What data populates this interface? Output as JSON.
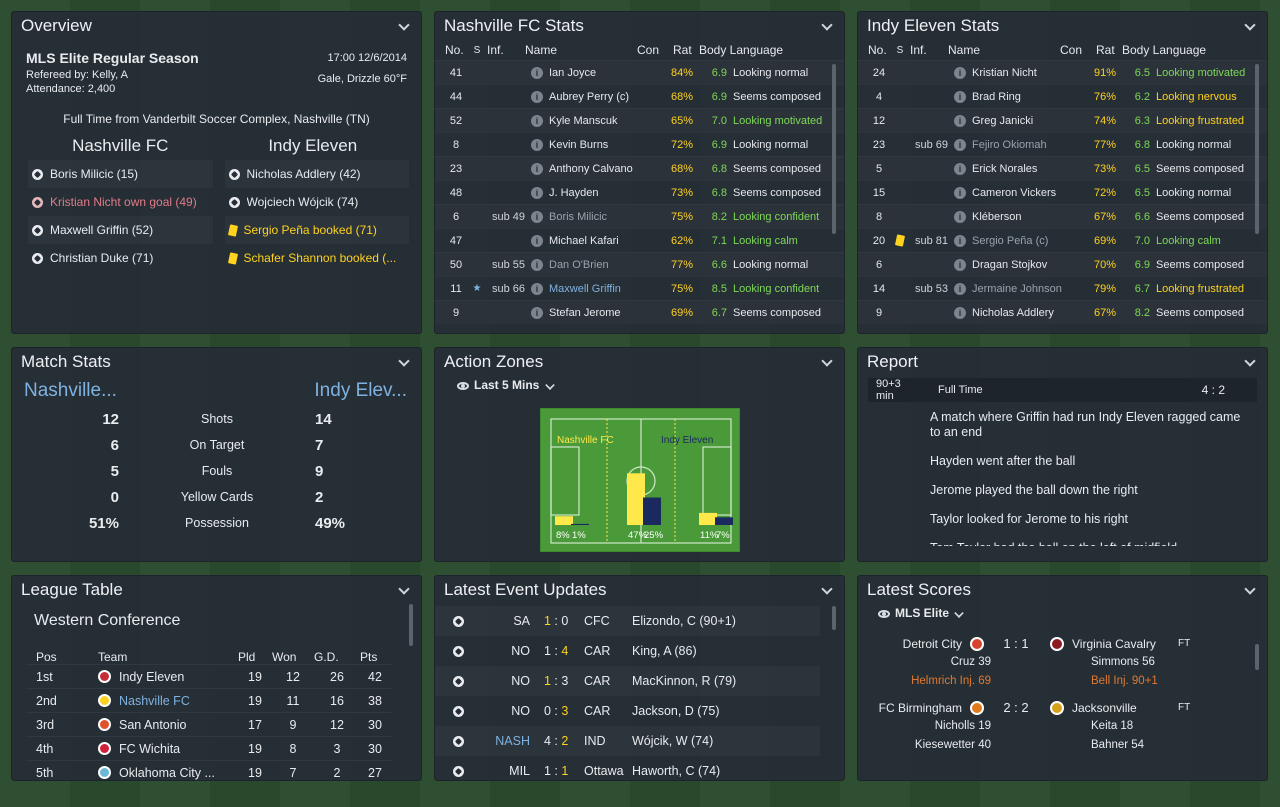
{
  "overview": {
    "title": "Overview",
    "competition": "MLS Elite Regular Season",
    "datetime": "17:00 12/6/2014",
    "referee": "Refereed by: Kelly, A",
    "weather": "Gale, Drizzle 60°F",
    "attendance": "Attendance: 2,400",
    "result": "Full Time from Vanderbilt Soccer Complex, Nashville (TN)",
    "home": "Nashville FC",
    "away": "Indy Eleven",
    "home_events": [
      {
        "text": "Boris Milicic (15)",
        "type": "goal"
      },
      {
        "text": "Kristian Nicht own goal (49)",
        "type": "own"
      },
      {
        "text": "Maxwell Griffin (52)",
        "type": "goal"
      },
      {
        "text": "Christian Duke (71)",
        "type": "goal"
      }
    ],
    "away_events": [
      {
        "text": "Nicholas Addlery (42)",
        "type": "goal"
      },
      {
        "text": "Wojciech Wójcik (74)",
        "type": "goal"
      },
      {
        "text": "Sergio Peña booked (71)",
        "type": "card"
      },
      {
        "text": "Schafer Shannon booked (...",
        "type": "card"
      }
    ]
  },
  "stats_headers": {
    "no": "No.",
    "s": "S",
    "inf": "Inf.",
    "name": "Name",
    "con": "Con",
    "rat": "Rat",
    "bl": "Body Language"
  },
  "home_stats": {
    "title": "Nashville FC Stats",
    "rows": [
      {
        "no": "41",
        "s": "",
        "inf": "",
        "name": "Ian Joyce",
        "con": "84%",
        "rat": "6.9",
        "bl": "Looking normal",
        "bc": "w"
      },
      {
        "no": "44",
        "s": "",
        "inf": "",
        "name": "Aubrey Perry (c)",
        "con": "68%",
        "rat": "6.9",
        "bl": "Seems composed",
        "bc": "w"
      },
      {
        "no": "52",
        "s": "",
        "inf": "",
        "name": "Kyle Manscuk",
        "con": "65%",
        "rat": "7.0",
        "bl": "Looking motivated",
        "bc": "g"
      },
      {
        "no": "8",
        "s": "",
        "inf": "",
        "name": "Kevin Burns",
        "con": "72%",
        "rat": "6.9",
        "bl": "Looking normal",
        "bc": "w"
      },
      {
        "no": "23",
        "s": "",
        "inf": "",
        "name": "Anthony Calvano",
        "con": "68%",
        "rat": "6.8",
        "bl": "Seems composed",
        "bc": "w"
      },
      {
        "no": "48",
        "s": "",
        "inf": "",
        "name": "J. Hayden",
        "con": "73%",
        "rat": "6.8",
        "bl": "Seems composed",
        "bc": "w"
      },
      {
        "no": "6",
        "s": "",
        "inf": "sub 49",
        "name": "Boris Milicic",
        "con": "75%",
        "rat": "8.2",
        "bl": "Looking confident",
        "bc": "g",
        "dim": true
      },
      {
        "no": "47",
        "s": "",
        "inf": "",
        "name": "Michael Kafari",
        "con": "62%",
        "rat": "7.1",
        "bl": "Looking calm",
        "bc": "g"
      },
      {
        "no": "50",
        "s": "",
        "inf": "sub 55",
        "name": "Dan O'Brien",
        "con": "77%",
        "rat": "6.6",
        "bl": "Looking normal",
        "bc": "w",
        "dim": true
      },
      {
        "no": "11",
        "s": "★",
        "inf": "sub 66",
        "name": "Maxwell Griffin",
        "con": "75%",
        "rat": "8.5",
        "bl": "Looking confident",
        "bc": "g",
        "link": true
      },
      {
        "no": "9",
        "s": "",
        "inf": "",
        "name": "Stefan Jerome",
        "con": "69%",
        "rat": "6.7",
        "bl": "Seems composed",
        "bc": "w"
      }
    ]
  },
  "away_stats": {
    "title": "Indy Eleven Stats",
    "rows": [
      {
        "no": "24",
        "s": "",
        "inf": "",
        "name": "Kristian Nicht",
        "con": "91%",
        "rat": "6.5",
        "bl": "Looking motivated",
        "bc": "g"
      },
      {
        "no": "4",
        "s": "",
        "inf": "",
        "name": "Brad Ring",
        "con": "76%",
        "rat": "6.2",
        "bl": "Looking nervous",
        "bc": "y"
      },
      {
        "no": "12",
        "s": "",
        "inf": "",
        "name": "Greg Janicki",
        "con": "74%",
        "rat": "6.3",
        "bl": "Looking frustrated",
        "bc": "y"
      },
      {
        "no": "23",
        "s": "",
        "inf": "sub 69",
        "name": "Fejiro Okiomah",
        "con": "77%",
        "rat": "6.8",
        "bl": "Looking normal",
        "bc": "w",
        "dim": true
      },
      {
        "no": "5",
        "s": "",
        "inf": "",
        "name": "Erick Norales",
        "con": "73%",
        "rat": "6.5",
        "bl": "Seems composed",
        "bc": "w"
      },
      {
        "no": "15",
        "s": "",
        "inf": "",
        "name": "Cameron Vickers",
        "con": "72%",
        "rat": "6.5",
        "bl": "Looking normal",
        "bc": "w"
      },
      {
        "no": "8",
        "s": "",
        "inf": "",
        "name": "Kléberson",
        "con": "67%",
        "rat": "6.6",
        "bl": "Seems composed",
        "bc": "w"
      },
      {
        "no": "20",
        "s": "card",
        "inf": "sub 81",
        "name": "Sergio Peña (c)",
        "con": "69%",
        "rat": "7.0",
        "bl": "Looking calm",
        "bc": "g",
        "dim": true
      },
      {
        "no": "6",
        "s": "",
        "inf": "",
        "name": "Dragan Stojkov",
        "con": "70%",
        "rat": "6.9",
        "bl": "Seems composed",
        "bc": "w"
      },
      {
        "no": "14",
        "s": "",
        "inf": "sub 53",
        "name": "Jermaine Johnson",
        "con": "79%",
        "rat": "6.7",
        "bl": "Looking frustrated",
        "bc": "y",
        "dim": true
      },
      {
        "no": "9",
        "s": "",
        "inf": "",
        "name": "Nicholas Addlery",
        "con": "67%",
        "rat": "8.2",
        "bl": "Seems composed",
        "bc": "w"
      }
    ]
  },
  "match_stats": {
    "title": "Match Stats",
    "home": "Nashville...",
    "away": "Indy Elev...",
    "rows": [
      {
        "h": "12",
        "label": "Shots",
        "a": "14"
      },
      {
        "h": "6",
        "label": "On Target",
        "a": "7"
      },
      {
        "h": "5",
        "label": "Fouls",
        "a": "9"
      },
      {
        "h": "0",
        "label": "Yellow Cards",
        "a": "2"
      },
      {
        "h": "51%",
        "label": "Possession",
        "a": "49%"
      }
    ]
  },
  "action_zones": {
    "title": "Action Zones",
    "filter": "Last 5 Mins",
    "home": "Nashville FC",
    "away": "Indy Eleven",
    "home_color": "#ffe84a",
    "away_color": "#1a2a5e",
    "zones": [
      {
        "home": 8,
        "away": 1,
        "home_label": "8%",
        "away_label": "1%"
      },
      {
        "home": 47,
        "away": 25,
        "home_label": "47%",
        "away_label": "25%"
      },
      {
        "home": 11,
        "away": 7,
        "home_label": "11%",
        "away_label": "7%"
      }
    ]
  },
  "report": {
    "title": "Report",
    "time": "90+3 min",
    "status": "Full Time",
    "score": "4 : 2",
    "lines": [
      "A match where Griffin had run Indy Eleven ragged came to an end",
      "Hayden went after the ball",
      "Jerome played the ball down the right",
      "Taylor looked for Jerome to his right",
      "Tom Taylor had the ball on the left of midfield"
    ]
  },
  "league": {
    "title": "League Table",
    "conference": "Western Conference",
    "headers": {
      "pos": "Pos",
      "team": "Team",
      "pld": "Pld",
      "won": "Won",
      "gd": "G.D.",
      "pts": "Pts"
    },
    "rows": [
      {
        "pos": "1st",
        "team": "Indy Eleven",
        "pld": "19",
        "won": "12",
        "gd": "26",
        "pts": "42",
        "color": "#c62d3a"
      },
      {
        "pos": "2nd",
        "team": "Nashville FC",
        "pld": "19",
        "won": "11",
        "gd": "16",
        "pts": "38",
        "color": "#ffd21f",
        "link": true
      },
      {
        "pos": "3rd",
        "team": "San Antonio",
        "pld": "17",
        "won": "9",
        "gd": "12",
        "pts": "30",
        "color": "#e0522a"
      },
      {
        "pos": "4th",
        "team": "FC Wichita",
        "pld": "19",
        "won": "8",
        "gd": "3",
        "pts": "30",
        "color": "#d0203a"
      },
      {
        "pos": "5th",
        "team": "Oklahoma City ...",
        "pld": "19",
        "won": "7",
        "gd": "2",
        "pts": "27",
        "color": "#6bb8d6"
      }
    ]
  },
  "events": {
    "title": "Latest Event Updates",
    "rows": [
      {
        "team": "SA",
        "hs": "1",
        "as": "0",
        "opp": "CFC",
        "desc": "Elizondo, C (90+1)",
        "hl": "h"
      },
      {
        "team": "NO",
        "hs": "1",
        "as": "4",
        "opp": "CAR",
        "desc": "King, A (86)",
        "hl": "a"
      },
      {
        "team": "NO",
        "hs": "1",
        "as": "3",
        "opp": "CAR",
        "desc": "MacKinnon, R (79)",
        "hl": "h"
      },
      {
        "team": "NO",
        "hs": "0",
        "as": "3",
        "opp": "CAR",
        "desc": "Jackson, D (75)",
        "hl": "a"
      },
      {
        "team": "NASH",
        "hs": "4",
        "as": "2",
        "opp": "IND",
        "desc": "Wójcik, W (74)",
        "hl": "a",
        "link": true
      },
      {
        "team": "MIL",
        "hs": "1",
        "as": "1",
        "opp": "Ottawa",
        "desc": "Haworth, C (74)",
        "hl": "a"
      }
    ]
  },
  "scores": {
    "title": "Latest Scores",
    "filter": "MLS Elite",
    "matches": [
      {
        "home": "Detroit City",
        "score": "1 : 1",
        "away": "Virginia Cavalry",
        "status": "FT",
        "hcolor": "#d8432f",
        "acolor": "#8b1a22",
        "hev": [
          "Cruz 39",
          "Helmrich Inj. 69"
        ],
        "aev": [
          "Simmons 56",
          "Bell Inj. 90+1"
        ]
      },
      {
        "home": "FC Birmingham",
        "score": "2 : 2",
        "away": "Jacksonville",
        "status": "FT",
        "hcolor": "#e07a1f",
        "acolor": "#d6a21a",
        "hev": [
          "Nicholls 19",
          "Kiesewetter 40"
        ],
        "aev": [
          "Keita 18",
          "Bahner 54"
        ]
      }
    ]
  }
}
